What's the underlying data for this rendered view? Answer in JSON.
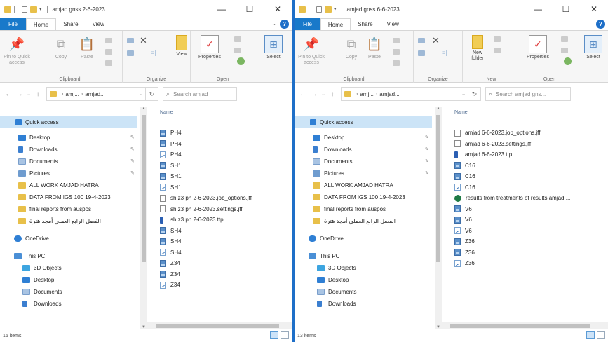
{
  "left": {
    "title": "amjad gnss 2-6-2023",
    "tabs": [
      "File",
      "Home",
      "Share",
      "View"
    ],
    "ribbon": {
      "pin_label": "Pin to Quick access",
      "copy_label": "Copy",
      "paste_label": "Paste",
      "view_label": "View",
      "properties_label": "Properties",
      "select_label": "Select",
      "group_clipboard": "Clipboard",
      "group_organize": "Organize",
      "group_open": "Open"
    },
    "address": [
      "amj...",
      "amjad..."
    ],
    "search_placeholder": "Search amjad",
    "column_name": "Name",
    "nav": {
      "quick_access": "Quick access",
      "items": [
        {
          "label": "Desktop",
          "icon": "desktop-icon",
          "pinned": true
        },
        {
          "label": "Downloads",
          "icon": "download-icon",
          "pinned": true
        },
        {
          "label": "Documents",
          "icon": "documents-icon",
          "pinned": true
        },
        {
          "label": "Pictures",
          "icon": "pictures-icon",
          "pinned": true
        },
        {
          "label": "ALL WORK AMJAD HATRA",
          "icon": "folder-icon",
          "pinned": false
        },
        {
          "label": "DATA FROM IGS 100 19-4-2023",
          "icon": "folder-icon",
          "pinned": false
        },
        {
          "label": "final reports from auspos",
          "icon": "folder-icon",
          "pinned": false
        },
        {
          "label": "الفصل الرابع العملي أمجد هترة",
          "icon": "folder-icon",
          "pinned": false
        }
      ],
      "onedrive": "OneDrive",
      "this_pc": "This PC",
      "pc_items": [
        {
          "label": "3D Objects",
          "icon": "3d-objects-icon"
        },
        {
          "label": "Desktop",
          "icon": "desktop-icon"
        },
        {
          "label": "Documents",
          "icon": "documents-icon"
        },
        {
          "label": "Downloads",
          "icon": "download-icon"
        }
      ]
    },
    "files": [
      {
        "name": "PH4",
        "type": "img"
      },
      {
        "name": "PH4",
        "type": "img"
      },
      {
        "name": "PH4",
        "type": "plot"
      },
      {
        "name": "SH1",
        "type": "img"
      },
      {
        "name": "SH1",
        "type": "img"
      },
      {
        "name": "SH1",
        "type": "plot"
      },
      {
        "name": "sh z3 ph 2-6-2023.job_options.jff",
        "type": "doc"
      },
      {
        "name": "sh z3 ph 2-6-2023.settings.jff",
        "type": "doc"
      },
      {
        "name": "sh z3 ph 2-6-2023.ttp",
        "type": "ttp"
      },
      {
        "name": "SH4",
        "type": "img"
      },
      {
        "name": "SH4",
        "type": "img"
      },
      {
        "name": "SH4",
        "type": "plot"
      },
      {
        "name": "Z34",
        "type": "img"
      },
      {
        "name": "Z34",
        "type": "img"
      },
      {
        "name": "Z34",
        "type": "plot"
      }
    ],
    "status": "15 items"
  },
  "right": {
    "title": "amjad gnss 6-6-2023",
    "tabs": [
      "File",
      "Home",
      "Share",
      "View"
    ],
    "ribbon": {
      "pin_label": "Pin to Quick access",
      "copy_label": "Copy",
      "paste_label": "Paste",
      "new_folder_label": "New folder",
      "properties_label": "Properties",
      "select_label": "Select",
      "group_clipboard": "Clipboard",
      "group_organize": "Organize",
      "group_new": "New",
      "group_open": "Open"
    },
    "address": [
      "amj...",
      "amjad..."
    ],
    "search_placeholder": "Search amjad gns...",
    "column_name": "Name",
    "nav": {
      "quick_access": "Quick access",
      "items": [
        {
          "label": "Desktop",
          "icon": "desktop-icon",
          "pinned": true
        },
        {
          "label": "Downloads",
          "icon": "download-icon",
          "pinned": true
        },
        {
          "label": "Documents",
          "icon": "documents-icon",
          "pinned": true
        },
        {
          "label": "Pictures",
          "icon": "pictures-icon",
          "pinned": true
        },
        {
          "label": "ALL WORK AMJAD HATRA",
          "icon": "folder-icon",
          "pinned": false
        },
        {
          "label": "DATA FROM IGS 100 19-4-2023",
          "icon": "folder-icon",
          "pinned": false
        },
        {
          "label": "final reports from auspos",
          "icon": "folder-icon",
          "pinned": false
        },
        {
          "label": "الفصل الرابع العملي أمجد هترة",
          "icon": "folder-icon",
          "pinned": false
        }
      ],
      "onedrive": "OneDrive",
      "this_pc": "This PC",
      "pc_items": [
        {
          "label": "3D Objects",
          "icon": "3d-objects-icon"
        },
        {
          "label": "Desktop",
          "icon": "desktop-icon"
        },
        {
          "label": "Documents",
          "icon": "documents-icon"
        },
        {
          "label": "Downloads",
          "icon": "download-icon"
        }
      ]
    },
    "files": [
      {
        "name": "amjad 6-6-2023.job_options.jff",
        "type": "doc"
      },
      {
        "name": "amjad 6-6-2023.settings.jff",
        "type": "doc"
      },
      {
        "name": "amjad 6-6-2023.ttp",
        "type": "ttp"
      },
      {
        "name": "C16",
        "type": "img"
      },
      {
        "name": "C16",
        "type": "img"
      },
      {
        "name": "C16",
        "type": "plot"
      },
      {
        "name": "results from treatments of results amjad ...",
        "type": "xls"
      },
      {
        "name": "V6",
        "type": "img"
      },
      {
        "name": "V6",
        "type": "img"
      },
      {
        "name": "V6",
        "type": "plot"
      },
      {
        "name": "Z36",
        "type": "img"
      },
      {
        "name": "Z36",
        "type": "img"
      },
      {
        "name": "Z36",
        "type": "plot"
      }
    ],
    "status": "13 items"
  },
  "colors": {
    "accent": "#1979ca",
    "selection": "#cce4f7",
    "folder": "#e8c04a",
    "split": "#1e6fc8"
  }
}
